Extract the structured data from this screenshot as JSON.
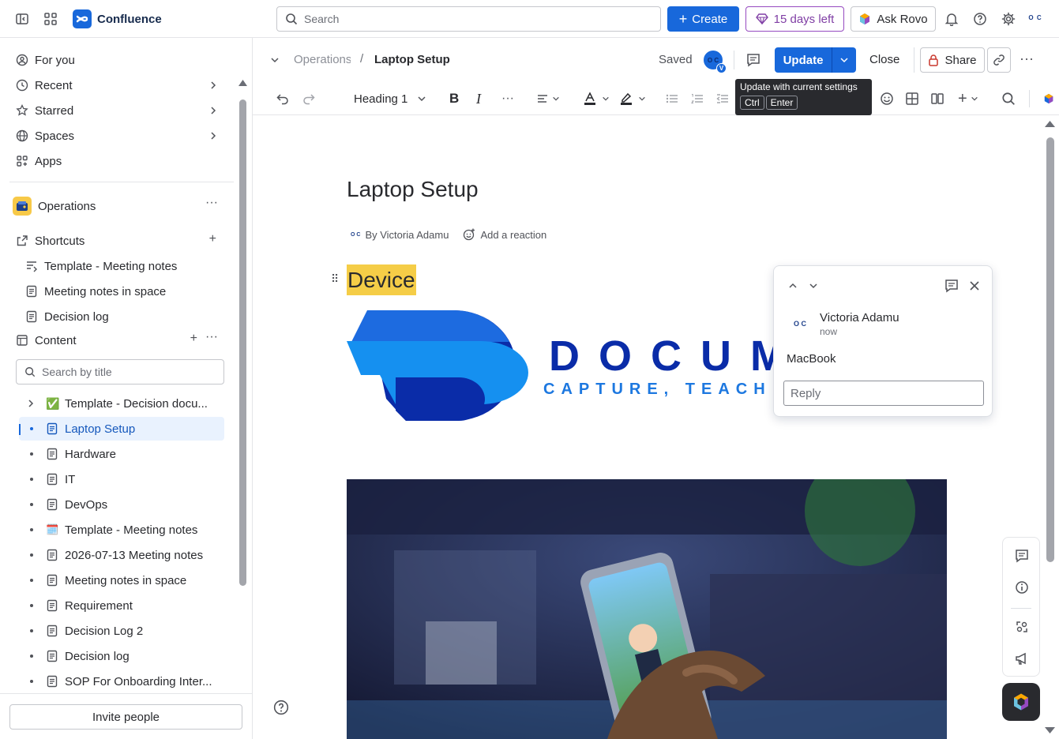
{
  "app": {
    "name": "Confluence"
  },
  "topnav": {
    "search_placeholder": "Search",
    "create_label": "Create",
    "trial_label": "15 days left",
    "rovo_label": "Ask Rovo",
    "avatar_initials": "O C"
  },
  "sidebar": {
    "nav": [
      {
        "label": "For you"
      },
      {
        "label": "Recent"
      },
      {
        "label": "Starred"
      },
      {
        "label": "Spaces"
      },
      {
        "label": "Apps"
      }
    ],
    "space_name": "Operations",
    "shortcuts_label": "Shortcuts",
    "shortcuts": [
      {
        "label": "Template - Meeting notes"
      },
      {
        "label": "Meeting notes in space"
      },
      {
        "label": "Decision log"
      }
    ],
    "content_label": "Content",
    "title_search_placeholder": "Search by title",
    "tree": [
      {
        "label": "Template - Decision docu...",
        "emoji": "✅"
      },
      {
        "label": "Laptop Setup"
      },
      {
        "label": "Hardware"
      },
      {
        "label": "IT"
      },
      {
        "label": "DevOps"
      },
      {
        "label": "Template - Meeting notes",
        "emoji": "🗓️"
      },
      {
        "label": "2026-07-13 Meeting notes"
      },
      {
        "label": "Meeting notes in space"
      },
      {
        "label": "Requirement"
      },
      {
        "label": "Decision Log 2"
      },
      {
        "label": "Decision log"
      },
      {
        "label": "SOP For Onboarding Inter..."
      }
    ],
    "invite_label": "Invite people"
  },
  "header": {
    "breadcrumb_space": "Operations",
    "breadcrumb_page": "Laptop Setup",
    "status": "Saved",
    "update_label": "Update",
    "close_label": "Close",
    "share_label": "Share"
  },
  "toolbar": {
    "text_style": "Heading 1",
    "tooltip_title": "Update with current settings",
    "tooltip_key1": "Ctrl",
    "tooltip_key2": "Enter"
  },
  "page": {
    "title": "Laptop Setup",
    "byline": "By Victoria Adamu",
    "add_reaction": "Add a reaction",
    "heading": "Device",
    "logo_letters": "DOCUM",
    "logo_tagline": "CAPTURE, TEACH"
  },
  "comment": {
    "author": "Victoria Adamu",
    "time": "now",
    "body": "MacBook",
    "reply_placeholder": "Reply"
  },
  "colors": {
    "brand_blue": "#1868db",
    "highlight_yellow": "#f5cd47",
    "trial_purple": "#803fa5"
  }
}
